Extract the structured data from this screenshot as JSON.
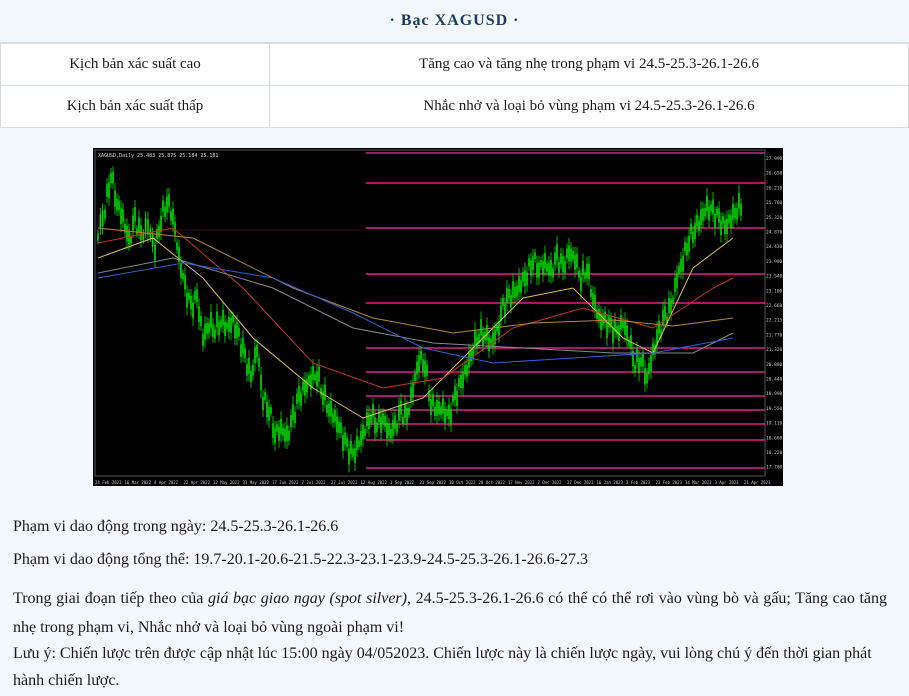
{
  "header": {
    "title": "· Bạc  XAGUSD  ·"
  },
  "scenarios": [
    {
      "label": "Kịch bản xác suất cao",
      "value": "Tăng cao và tăng nhẹ trong phạm vi 24.5-25.3-26.1-26.6"
    },
    {
      "label": "Kịch bản xác suất thấp",
      "value": "Nhắc nhở và loại bỏ vùng phạm vi 24.5-25.3-26.1-26.6"
    }
  ],
  "chart": {
    "title_text": "XAGUSD,Daily  25.483 25.875 25.184 25.181",
    "price_labels": [
      "27.990",
      "26.650",
      "26.210",
      "25.760",
      "25.320",
      "24.870",
      "24.430",
      "23.990",
      "23.540",
      "23.100",
      "22.660",
      "22.215",
      "21.770",
      "21.320",
      "20.880",
      "20.440",
      "19.990",
      "19.550",
      "19.110",
      "18.660",
      "18.220",
      "17.780"
    ],
    "date_labels": [
      "24 Feb 2022",
      "16 Mar 2022",
      "4 Apr 2022",
      "22 Apr 2022",
      "12 May 2022",
      "31 May 2022",
      "17 Jun 2022",
      "7 Jul 2022",
      "27 Jul 2022",
      "12 Aug 2022",
      "1 Sep 2022",
      "21 Sep 2022",
      "10 Oct 2022",
      "28 Oct 2022",
      "17 Nov 2022",
      "7 Dec 2022",
      "27 Dec 2022",
      "16 Jan 2023",
      "3 Feb 2023",
      "23 Feb 2023",
      "14 Mar 2023",
      "3 Apr 2023",
      "21 Apr 2023"
    ],
    "colors": {
      "bg": "#000000",
      "candles": "#00e000",
      "levels": "#ff2aa0",
      "ma_fast": "#d7c15a",
      "ma_mid": "#c0392b",
      "ma_slow": "#b08a3a",
      "ma_long": "#7f8c8d",
      "ma_blue": "#3060d0"
    }
  },
  "para1": "Phạm vi dao động trong ngày: 24.5-25.3-26.1-26.6",
  "para2": "Phạm vi dao động tổng thể: 19.7-20.1-20.6-21.5-22.3-23.1-23.9-24.5-25.3-26.1-26.6-27.3",
  "para3": {
    "start": "Trong giai đoạn tiếp theo của ",
    "italic": "giá bạc giao ngay (spot silver)",
    "end": ", 24.5-25.3-26.1-26.6 có thể có thể rơi vào vùng bò và gấu; Tăng cao tăng nhẹ trong phạm vi, Nhắc nhở và loại bỏ vùng ngoài phạm vi!"
  },
  "para4": "Lưu ý: Chiến lược trên được cập nhật lúc 15:00 ngày 04/052023. Chiến lược này là chiến lược ngày, vui lòng chú ý đến thời gian phát hành chiến lược."
}
